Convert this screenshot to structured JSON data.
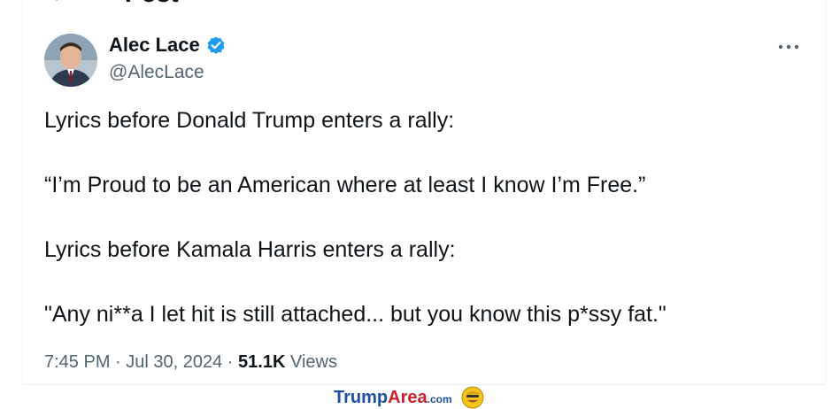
{
  "header": {
    "back_icon": "back-arrow-icon",
    "title": "Post"
  },
  "author": {
    "display_name": "Alec Lace",
    "handle": "@AlecLace",
    "verified_icon": "verified-badge-icon",
    "verified_color": "#1d9bf0"
  },
  "more_icon": "more-horizontal-icon",
  "tweet": {
    "paragraphs": [
      "Lyrics before Donald Trump enters a rally:",
      "“I’m Proud to be an American where at least I know I’m Free.”",
      "Lyrics before Kamala Harris enters a rally:",
      "\"Any ni**a I let hit is still attached... but you know this p*ssy fat.\""
    ]
  },
  "meta": {
    "time": "7:45 PM",
    "separator": " · ",
    "date": "Jul 30, 2024",
    "views_count": "51.1K",
    "views_label": " Views"
  },
  "watermark": {
    "part1": "Trump",
    "part2": "Area",
    "part3": ".com",
    "icon": "smiley-face-icon"
  }
}
